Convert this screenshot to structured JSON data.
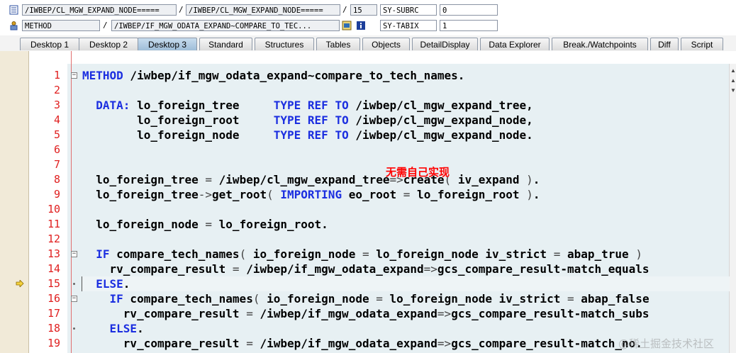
{
  "info": {
    "row1": {
      "field1": "/IWBEP/CL_MGW_EXPAND_NODE=====",
      "sep1": "/",
      "field2": "/IWBEP/CL_MGW_EXPAND_NODE=====",
      "sep2": "/",
      "line_no": "15",
      "var_name": "SY-SUBRC",
      "var_value": "0"
    },
    "row2": {
      "field1": "METHOD",
      "sep1": "/",
      "field2": "/IWBEP/IF_MGW_ODATA_EXPAND~COMPARE_TO_TEC...",
      "var_name": "SY-TABIX",
      "var_value": "1"
    }
  },
  "tabs": [
    {
      "label": "Desktop 1",
      "active": false
    },
    {
      "label": "Desktop 2",
      "active": false
    },
    {
      "label": "Desktop 3",
      "active": true
    },
    {
      "label": "Standard",
      "active": false
    },
    {
      "label": "Structures",
      "active": false
    },
    {
      "label": "Tables",
      "active": false
    },
    {
      "label": "Objects",
      "active": false
    },
    {
      "label": "DetailDisplay",
      "active": false
    },
    {
      "label": "Data Explorer",
      "active": false
    },
    {
      "label": "Break./Watchpoints",
      "active": false
    },
    {
      "label": "Diff",
      "active": false
    },
    {
      "label": "Script",
      "active": false
    }
  ],
  "editor": {
    "current_line": 15,
    "annotation": "无需自己实现",
    "watermark": "@稀土掘金技术社区",
    "lines": [
      {
        "n": "1",
        "text": "METHOD /iwbep/if_mgw_odata_expand~compare_to_tech_names."
      },
      {
        "n": "2",
        "text": ""
      },
      {
        "n": "3",
        "text": "  DATA: lo_foreign_tree     TYPE REF TO /iwbep/cl_mgw_expand_tree,"
      },
      {
        "n": "4",
        "text": "        lo_foreign_root     TYPE REF TO /iwbep/cl_mgw_expand_node,"
      },
      {
        "n": "5",
        "text": "        lo_foreign_node     TYPE REF TO /iwbep/cl_mgw_expand_node."
      },
      {
        "n": "6",
        "text": ""
      },
      {
        "n": "7",
        "text": ""
      },
      {
        "n": "8",
        "text": "  lo_foreign_tree = /iwbep/cl_mgw_expand_tree=>create( iv_expand )."
      },
      {
        "n": "9",
        "text": "  lo_foreign_tree->get_root( IMPORTING eo_root = lo_foreign_root )."
      },
      {
        "n": "10",
        "text": ""
      },
      {
        "n": "11",
        "text": "  lo_foreign_node = lo_foreign_root."
      },
      {
        "n": "12",
        "text": ""
      },
      {
        "n": "13",
        "text": "  IF compare_tech_names( io_foreign_node = lo_foreign_node iv_strict = abap_true )"
      },
      {
        "n": "14",
        "text": "    rv_compare_result = /iwbep/if_mgw_odata_expand=>gcs_compare_result-match_equals"
      },
      {
        "n": "15",
        "text": "  ELSE."
      },
      {
        "n": "16",
        "text": "    IF compare_tech_names( io_foreign_node = lo_foreign_node iv_strict = abap_false"
      },
      {
        "n": "17",
        "text": "      rv_compare_result = /iwbep/if_mgw_odata_expand=>gcs_compare_result-match_subs"
      },
      {
        "n": "18",
        "text": "    ELSE."
      },
      {
        "n": "19",
        "text": "      rv_compare_result = /iwbep/if_mgw_odata_expand=>gcs_compare_result-match_no."
      }
    ]
  }
}
